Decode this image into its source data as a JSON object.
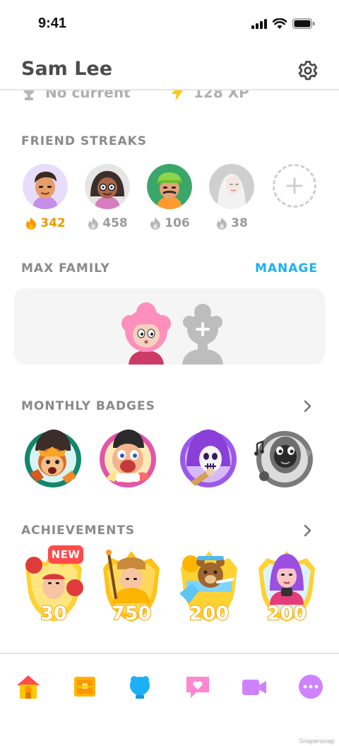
{
  "status_bar": {
    "time": "9:41"
  },
  "header": {
    "title": "Sam Lee",
    "settings_icon": "gear-icon"
  },
  "scroll_peek": {
    "league": "No current",
    "xp": "128 XP"
  },
  "friend_streaks": {
    "label": "FRIEND STREAKS",
    "friends": [
      {
        "streak": "342",
        "active": true,
        "bg": "#e8dcfb"
      },
      {
        "streak": "458",
        "active": false,
        "bg": "#e5e5e5"
      },
      {
        "streak": "106",
        "active": false,
        "bg": "#3aa66a"
      },
      {
        "streak": "38",
        "active": false,
        "bg": "#cfcfcf"
      }
    ],
    "add_icon": "plus-icon"
  },
  "max_family": {
    "label": "MAX FAMILY",
    "manage": "MANAGE"
  },
  "monthly_badges": {
    "label": "MONTHLY BADGES"
  },
  "achievements": {
    "label": "ACHIEVEMENTS",
    "new_tag": "NEW",
    "items": [
      {
        "value": "30"
      },
      {
        "value": "750"
      },
      {
        "value": "200"
      },
      {
        "value": "200"
      }
    ]
  },
  "tabs": [
    "home-icon",
    "treasure-icon",
    "shield-icon",
    "heart-chat-icon",
    "video-icon",
    "more-icon"
  ],
  "colors": {
    "accent": "#1cb0f6",
    "streak_active": "#ff9600",
    "new_badge": "#ff4b4b"
  },
  "watermark": "Snapensnap"
}
